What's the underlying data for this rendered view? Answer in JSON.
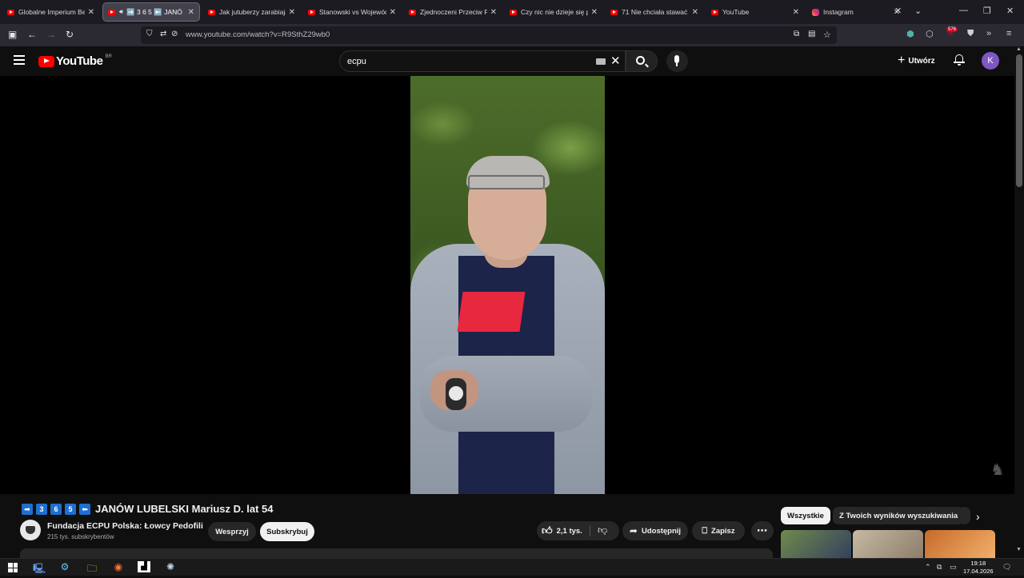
{
  "browser": {
    "tabs": [
      {
        "title": "Globalne Imperium Bezk",
        "fav": "youtube"
      },
      {
        "title": "➡️ 3 6 5 ⬅️ JANÓ",
        "fav": "youtube",
        "active": true
      },
      {
        "title": "Jak jutuberzy zarabiają n",
        "fav": "youtube"
      },
      {
        "title": "Stanowski vs Wojewódzk",
        "fav": "youtube"
      },
      {
        "title": "Zjednoczeni Przeciw Ras",
        "fav": "youtube"
      },
      {
        "title": "Czy nic nie dzieje się prz",
        "fav": "youtube"
      },
      {
        "title": "71 Nie chciała stawać (M",
        "fav": "youtube"
      },
      {
        "title": "YouTube",
        "fav": "youtube"
      },
      {
        "title": "Instagram",
        "fav": "instagram"
      }
    ],
    "url": "www.youtube.com/watch?v=R9SthZ29wb0",
    "ext_badge": "576"
  },
  "youtube": {
    "logo_text": "YouTube",
    "country_code": "BR",
    "search_query": "ecpu",
    "create_label": "Utwórz",
    "avatar_letter": "K"
  },
  "video": {
    "title_keycaps": [
      "➡",
      "3",
      "6",
      "5",
      "⬅"
    ],
    "title": "JANÓW LUBELSKI Mariusz D. lat 54",
    "channel_name": "Fundacja ECPU Polska: Łowcy Pedofili",
    "subscribers": "215 tys. subskrybentów",
    "support_label": "Wesprzyj",
    "subscribe_label": "Subskrybuj",
    "likes": "2,1 tys.",
    "share_label": "Udostępnij",
    "save_label": "Zapisz"
  },
  "related": {
    "chips": [
      "Wszystkie",
      "Z Twoich wyników wyszukiwania"
    ]
  },
  "taskbar": {
    "time": "19:18",
    "date": "17.04.2026"
  }
}
